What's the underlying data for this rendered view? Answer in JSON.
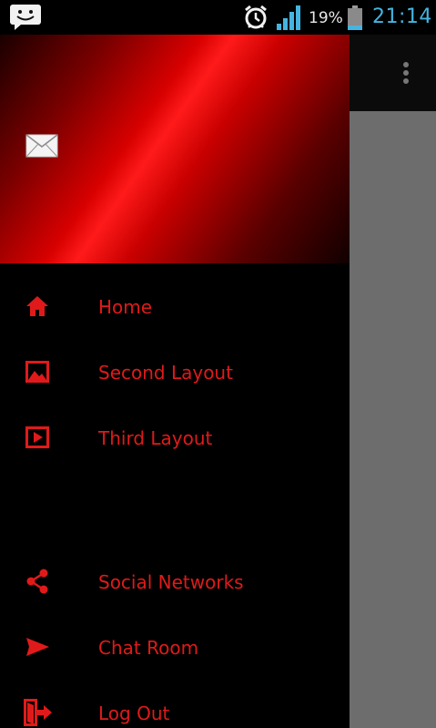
{
  "status_bar": {
    "battery_percent": "19%",
    "time": "21:14",
    "icons": [
      "messenger-icon",
      "alarm-icon",
      "signal-icon",
      "battery-icon"
    ]
  },
  "app_bar": {
    "overflow_icon": "more-vert-icon"
  },
  "drawer": {
    "header_icon": "mail-icon",
    "items": [
      {
        "label": "Home",
        "icon": "home-icon"
      },
      {
        "label": "Second Layout",
        "icon": "image-icon"
      },
      {
        "label": "Third Layout",
        "icon": "play-box-icon"
      },
      {
        "label": "Social Networks",
        "icon": "share-icon"
      },
      {
        "label": "Chat Room",
        "icon": "send-icon"
      },
      {
        "label": "Log Out",
        "icon": "logout-icon"
      }
    ]
  },
  "colors": {
    "accent": "#e01a1a",
    "time": "#45b4e0",
    "content_background": "#6d6d6d"
  }
}
